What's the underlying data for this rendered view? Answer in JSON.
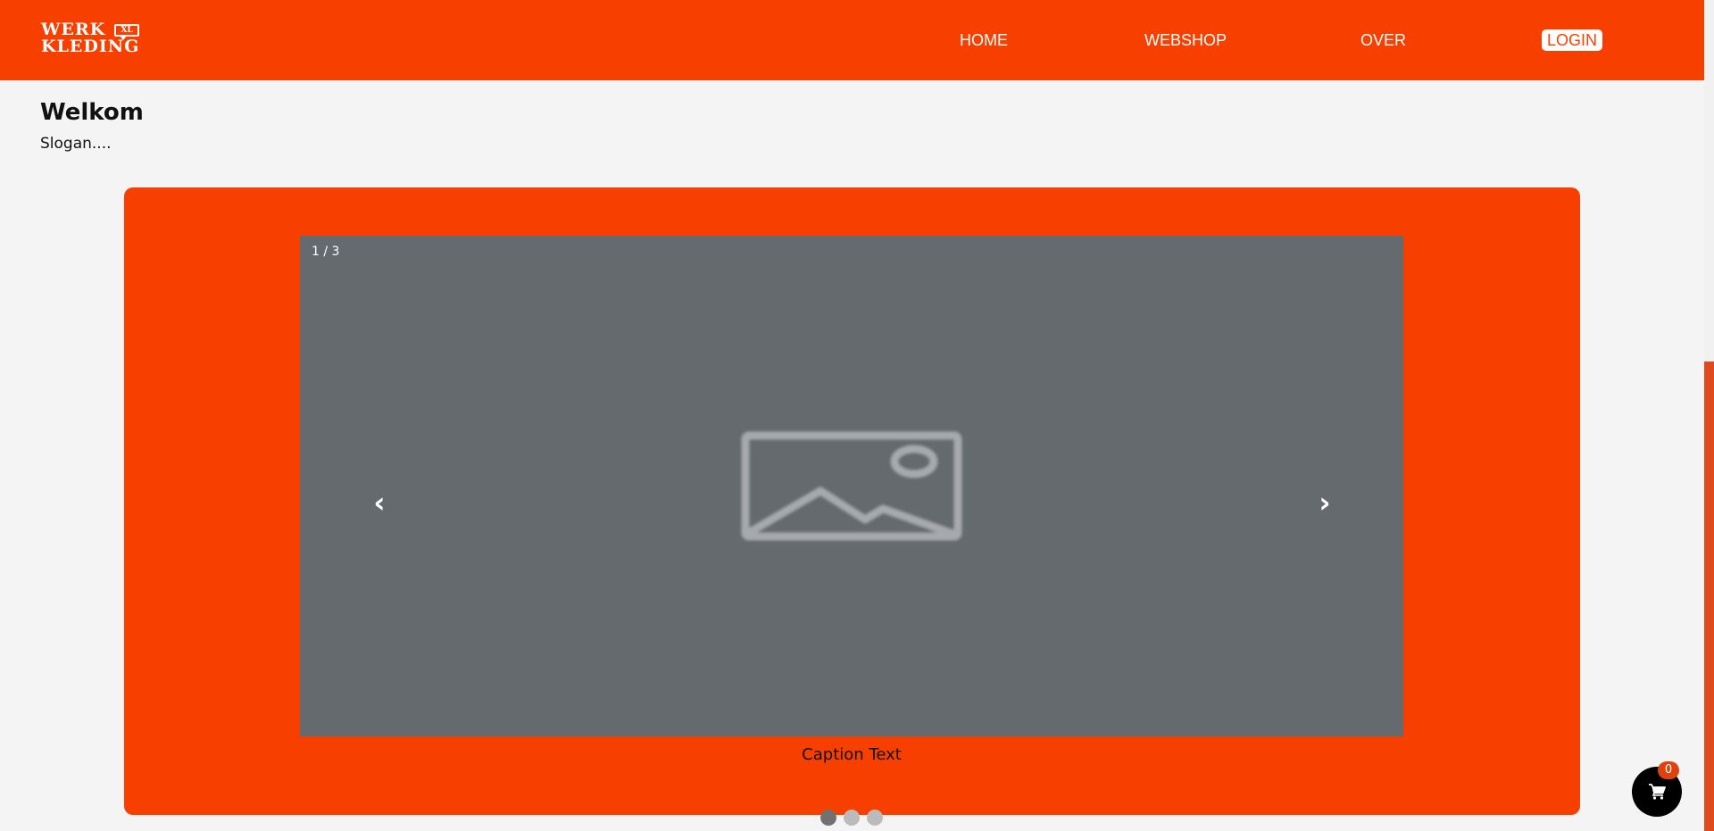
{
  "header": {
    "logo": {
      "line1": "WERK",
      "line2": "KLEDING",
      "badge": "XL"
    },
    "nav": {
      "home": "HOME",
      "webshop": "WEBSHOP",
      "over": "OVER",
      "login": "LOGIN"
    }
  },
  "intro": {
    "title": "Welkom",
    "slogan": "Slogan...."
  },
  "slideshow": {
    "counter": "1 / 3",
    "current_slide": 1,
    "total_slides": 3,
    "prev_label": "‹",
    "next_label": "›",
    "caption": "Caption Text",
    "image_icon": "image-placeholder-icon"
  },
  "cart": {
    "count": "0",
    "icon": "cart-icon"
  },
  "colors": {
    "brand": "#f74000",
    "slide_background": "#656a6f",
    "dot_active": "#717171",
    "dot_inactive": "#bbbbbb",
    "cart_button": "#000000",
    "cart_badge": "#e0420f"
  }
}
